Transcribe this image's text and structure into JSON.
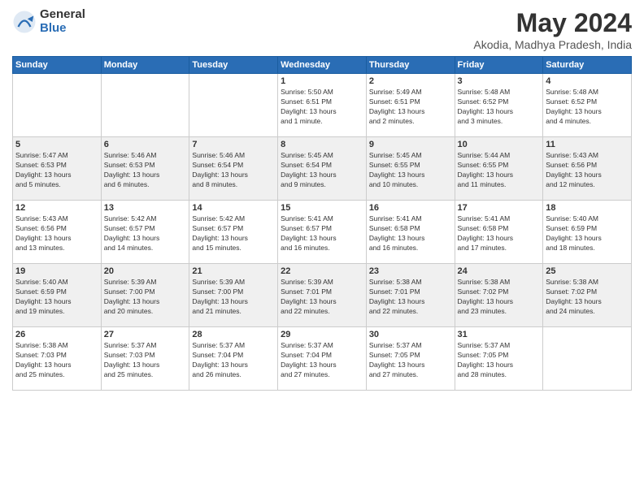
{
  "logo": {
    "general": "General",
    "blue": "Blue"
  },
  "title": "May 2024",
  "subtitle": "Akodia, Madhya Pradesh, India",
  "days_header": [
    "Sunday",
    "Monday",
    "Tuesday",
    "Wednesday",
    "Thursday",
    "Friday",
    "Saturday"
  ],
  "weeks": [
    [
      {
        "day": "",
        "info": ""
      },
      {
        "day": "",
        "info": ""
      },
      {
        "day": "",
        "info": ""
      },
      {
        "day": "1",
        "info": "Sunrise: 5:50 AM\nSunset: 6:51 PM\nDaylight: 13 hours\nand 1 minute."
      },
      {
        "day": "2",
        "info": "Sunrise: 5:49 AM\nSunset: 6:51 PM\nDaylight: 13 hours\nand 2 minutes."
      },
      {
        "day": "3",
        "info": "Sunrise: 5:48 AM\nSunset: 6:52 PM\nDaylight: 13 hours\nand 3 minutes."
      },
      {
        "day": "4",
        "info": "Sunrise: 5:48 AM\nSunset: 6:52 PM\nDaylight: 13 hours\nand 4 minutes."
      }
    ],
    [
      {
        "day": "5",
        "info": "Sunrise: 5:47 AM\nSunset: 6:53 PM\nDaylight: 13 hours\nand 5 minutes."
      },
      {
        "day": "6",
        "info": "Sunrise: 5:46 AM\nSunset: 6:53 PM\nDaylight: 13 hours\nand 6 minutes."
      },
      {
        "day": "7",
        "info": "Sunrise: 5:46 AM\nSunset: 6:54 PM\nDaylight: 13 hours\nand 8 minutes."
      },
      {
        "day": "8",
        "info": "Sunrise: 5:45 AM\nSunset: 6:54 PM\nDaylight: 13 hours\nand 9 minutes."
      },
      {
        "day": "9",
        "info": "Sunrise: 5:45 AM\nSunset: 6:55 PM\nDaylight: 13 hours\nand 10 minutes."
      },
      {
        "day": "10",
        "info": "Sunrise: 5:44 AM\nSunset: 6:55 PM\nDaylight: 13 hours\nand 11 minutes."
      },
      {
        "day": "11",
        "info": "Sunrise: 5:43 AM\nSunset: 6:56 PM\nDaylight: 13 hours\nand 12 minutes."
      }
    ],
    [
      {
        "day": "12",
        "info": "Sunrise: 5:43 AM\nSunset: 6:56 PM\nDaylight: 13 hours\nand 13 minutes."
      },
      {
        "day": "13",
        "info": "Sunrise: 5:42 AM\nSunset: 6:57 PM\nDaylight: 13 hours\nand 14 minutes."
      },
      {
        "day": "14",
        "info": "Sunrise: 5:42 AM\nSunset: 6:57 PM\nDaylight: 13 hours\nand 15 minutes."
      },
      {
        "day": "15",
        "info": "Sunrise: 5:41 AM\nSunset: 6:57 PM\nDaylight: 13 hours\nand 16 minutes."
      },
      {
        "day": "16",
        "info": "Sunrise: 5:41 AM\nSunset: 6:58 PM\nDaylight: 13 hours\nand 16 minutes."
      },
      {
        "day": "17",
        "info": "Sunrise: 5:41 AM\nSunset: 6:58 PM\nDaylight: 13 hours\nand 17 minutes."
      },
      {
        "day": "18",
        "info": "Sunrise: 5:40 AM\nSunset: 6:59 PM\nDaylight: 13 hours\nand 18 minutes."
      }
    ],
    [
      {
        "day": "19",
        "info": "Sunrise: 5:40 AM\nSunset: 6:59 PM\nDaylight: 13 hours\nand 19 minutes."
      },
      {
        "day": "20",
        "info": "Sunrise: 5:39 AM\nSunset: 7:00 PM\nDaylight: 13 hours\nand 20 minutes."
      },
      {
        "day": "21",
        "info": "Sunrise: 5:39 AM\nSunset: 7:00 PM\nDaylight: 13 hours\nand 21 minutes."
      },
      {
        "day": "22",
        "info": "Sunrise: 5:39 AM\nSunset: 7:01 PM\nDaylight: 13 hours\nand 22 minutes."
      },
      {
        "day": "23",
        "info": "Sunrise: 5:38 AM\nSunset: 7:01 PM\nDaylight: 13 hours\nand 22 minutes."
      },
      {
        "day": "24",
        "info": "Sunrise: 5:38 AM\nSunset: 7:02 PM\nDaylight: 13 hours\nand 23 minutes."
      },
      {
        "day": "25",
        "info": "Sunrise: 5:38 AM\nSunset: 7:02 PM\nDaylight: 13 hours\nand 24 minutes."
      }
    ],
    [
      {
        "day": "26",
        "info": "Sunrise: 5:38 AM\nSunset: 7:03 PM\nDaylight: 13 hours\nand 25 minutes."
      },
      {
        "day": "27",
        "info": "Sunrise: 5:37 AM\nSunset: 7:03 PM\nDaylight: 13 hours\nand 25 minutes."
      },
      {
        "day": "28",
        "info": "Sunrise: 5:37 AM\nSunset: 7:04 PM\nDaylight: 13 hours\nand 26 minutes."
      },
      {
        "day": "29",
        "info": "Sunrise: 5:37 AM\nSunset: 7:04 PM\nDaylight: 13 hours\nand 27 minutes."
      },
      {
        "day": "30",
        "info": "Sunrise: 5:37 AM\nSunset: 7:05 PM\nDaylight: 13 hours\nand 27 minutes."
      },
      {
        "day": "31",
        "info": "Sunrise: 5:37 AM\nSunset: 7:05 PM\nDaylight: 13 hours\nand 28 minutes."
      },
      {
        "day": "",
        "info": ""
      }
    ]
  ]
}
